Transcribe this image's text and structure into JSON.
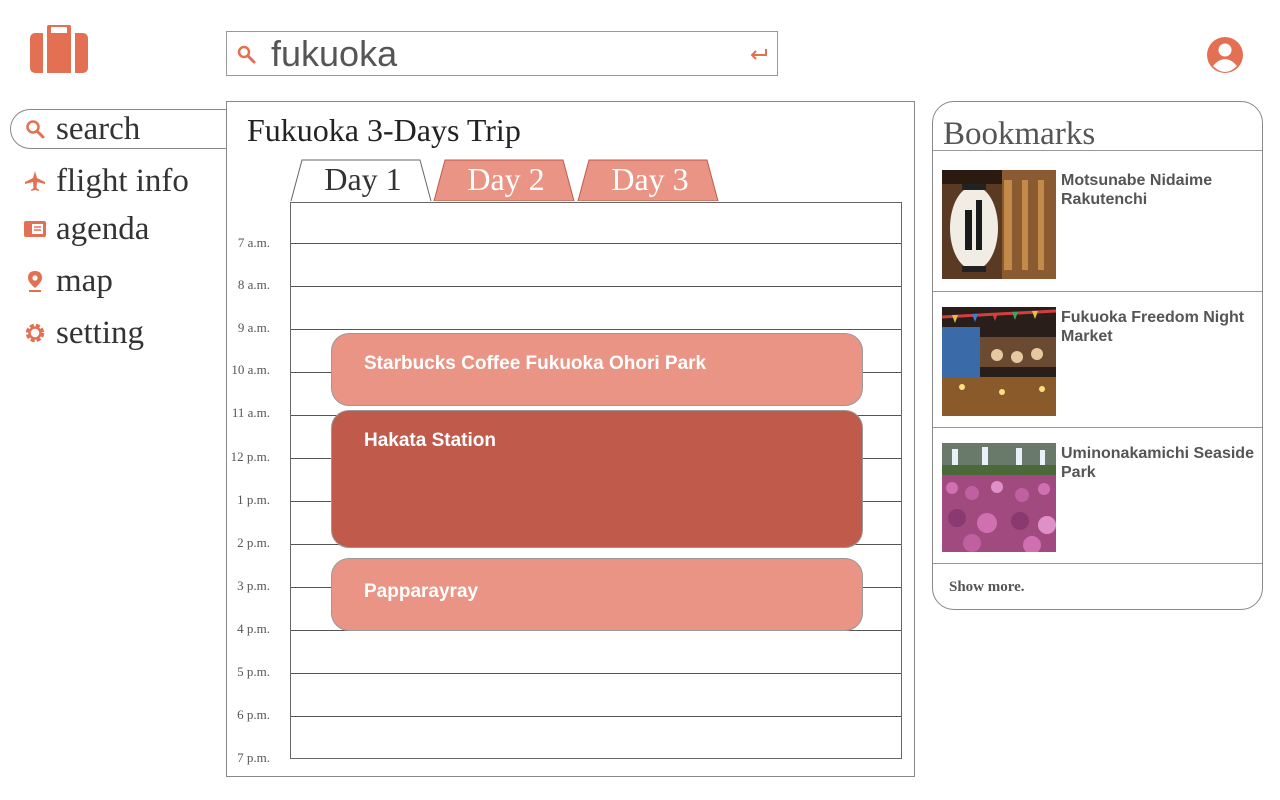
{
  "colors": {
    "accent": "#e47054",
    "event_light": "#e99484",
    "event_dark": "#c05a4b",
    "tab_inactive": "#e99484"
  },
  "header": {
    "logo_icon": "briefcase-icon",
    "search": {
      "value": "fukuoka",
      "icon": "search-icon",
      "enter_icon": "enter-icon"
    },
    "profile_icon": "user-circle-icon"
  },
  "nav": {
    "items": [
      {
        "label": "search",
        "icon": "search-icon"
      },
      {
        "label": "flight info",
        "icon": "airplane-icon"
      },
      {
        "label": "agenda",
        "icon": "agenda-icon",
        "active": true
      },
      {
        "label": "map",
        "icon": "map-pin-icon"
      },
      {
        "label": "setting",
        "icon": "gear-icon"
      }
    ]
  },
  "main": {
    "title": "Fukuoka 3-Days Trip",
    "tabs": [
      {
        "label": "Day 1",
        "active": true
      },
      {
        "label": "Day 2",
        "active": false
      },
      {
        "label": "Day 3",
        "active": false
      }
    ],
    "hours": [
      "7 a.m.",
      "8 a.m.",
      "9 a.m.",
      "10 a.m.",
      "11 a.m.",
      "12 p.m.",
      "1 p.m.",
      "2 p.m.",
      "3 p.m.",
      "4 p.m.",
      "5 p.m.",
      "6 p.m.",
      "7 p.m."
    ],
    "events": [
      {
        "label": "Starbucks Coffee Fukuoka Ohori Park"
      },
      {
        "label": "Hakata Station"
      },
      {
        "label": "Papparayray"
      }
    ]
  },
  "bookmarks": {
    "title": "Bookmarks",
    "items": [
      {
        "name": "Motsunabe Nidaime Rakutenchi"
      },
      {
        "name": "Fukuoka Freedom Night Market"
      },
      {
        "name": "Uminonakamichi Seaside Park"
      }
    ],
    "show_more": "Show more."
  }
}
